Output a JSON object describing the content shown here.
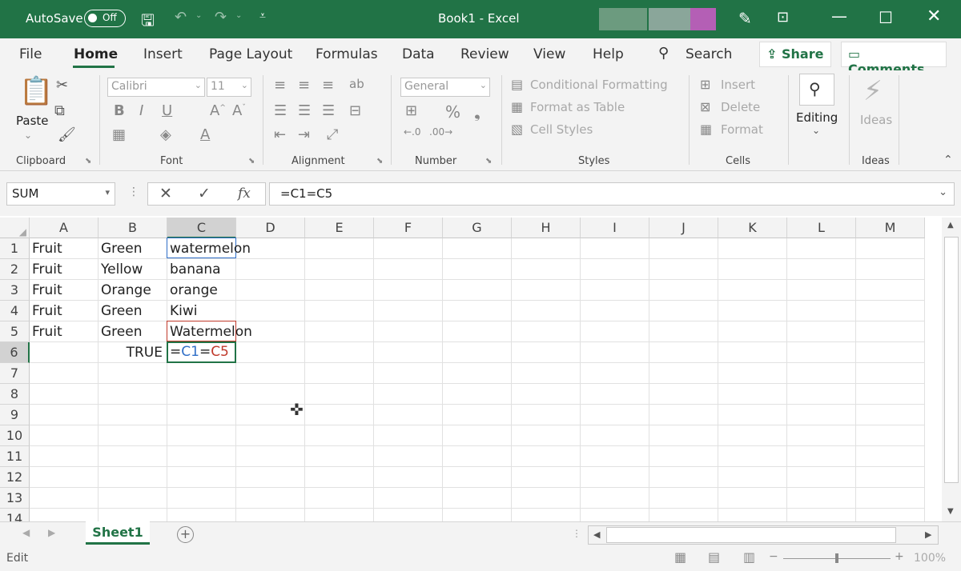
{
  "titlebar": {
    "autosave_label": "AutoSave",
    "autosave_state": "Off",
    "document_title": "Book1  -  Excel"
  },
  "tabs": {
    "items": [
      "File",
      "Home",
      "Insert",
      "Page Layout",
      "Formulas",
      "Data",
      "Review",
      "View",
      "Help"
    ],
    "search_label": "Search",
    "share_label": "Share",
    "comments_label": "Comments"
  },
  "ribbon": {
    "clipboard": {
      "paste_label": "Paste",
      "group_label": "Clipboard"
    },
    "font": {
      "font_name": "Calibri",
      "font_size": "11",
      "group_label": "Font"
    },
    "alignment": {
      "group_label": "Alignment"
    },
    "number": {
      "format": "General",
      "group_label": "Number"
    },
    "styles": {
      "conditional_formatting": "Conditional Formatting",
      "format_as_table": "Format as Table",
      "cell_styles": "Cell Styles",
      "group_label": "Styles"
    },
    "cells": {
      "insert": "Insert",
      "delete": "Delete",
      "format": "Format",
      "group_label": "Cells"
    },
    "editing": {
      "label": "Editing"
    },
    "ideas": {
      "label": "Ideas",
      "group_label": "Ideas"
    }
  },
  "formula_bar": {
    "name_box": "SUM",
    "formula": "=C1=C5"
  },
  "grid": {
    "columns": [
      "A",
      "B",
      "C",
      "D",
      "E",
      "F",
      "G",
      "H",
      "I",
      "J",
      "K",
      "L",
      "M"
    ],
    "rows": [
      "1",
      "2",
      "3",
      "4",
      "5",
      "6",
      "7",
      "8",
      "9",
      "10",
      "11",
      "12",
      "13",
      "14"
    ],
    "cells": {
      "A1": "Fruit",
      "B1": "Green",
      "C1": "watermelon",
      "A2": "Fruit",
      "B2": "Yellow",
      "C2": "banana",
      "A3": "Fruit",
      "B3": "Orange",
      "C3": "orange",
      "A4": "Fruit",
      "B4": "Green",
      "C4": "Kiwi",
      "A5": "Fruit",
      "B5": "Green",
      "C5": "Watermelon",
      "B6": "TRUE"
    },
    "edit_cell": {
      "eq1": "=",
      "ref1": "C1",
      "eq2": "=",
      "ref2": "C5"
    },
    "colors": {
      "ref1": "#2f6ec7",
      "ref2": "#c0392b",
      "active": "#217346"
    }
  },
  "sheets": {
    "active": "Sheet1"
  },
  "status": {
    "mode": "Edit",
    "zoom": "100%"
  }
}
